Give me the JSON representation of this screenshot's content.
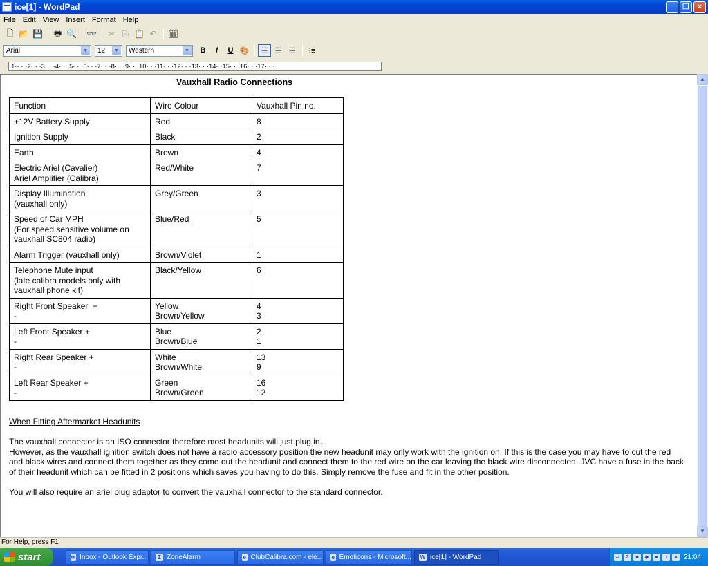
{
  "window": {
    "title": "ice[1] - WordPad",
    "minimize": "_",
    "maximize": "❐",
    "close": "×"
  },
  "menu": [
    "File",
    "Edit",
    "View",
    "Insert",
    "Format",
    "Help"
  ],
  "format_bar": {
    "font": "Arial",
    "size": "12",
    "script": "Western",
    "bold": "B",
    "italic": "I",
    "underline": "U"
  },
  "ruler": "·1·· · ·2· · ·3· · ·4· · ·5· · ·6· · ·7· · ·8· · ·9· · ·10· · ·11· · ·12· · ·13· · ·14· ·15· · ·16· · ·17· · ·",
  "document": {
    "title": "Vauxhall Radio Connections",
    "table": {
      "headers": [
        "Function",
        "Wire Colour",
        "Vauxhall Pin no."
      ],
      "rows": [
        [
          "+12V Battery Supply",
          "Red",
          "8"
        ],
        [
          "Ignition Supply",
          "Black",
          "2"
        ],
        [
          "Earth",
          "Brown",
          "4"
        ],
        [
          "Electric Ariel (Cavalier)\nAriel Amplifier (Calibra)",
          "Red/White",
          "7"
        ],
        [
          "Display Illumination\n(vauxhall only)",
          "Grey/Green",
          "3"
        ],
        [
          "Speed of Car MPH\n(For speed sensitive volume on\nvauxhall SC804 radio)",
          "Blue/Red",
          "5"
        ],
        [
          "Alarm Trigger (vauxhall only)",
          "Brown/Violet",
          "1"
        ],
        [
          "Telephone Mute input\n(late calibra models only with\nvauxhall phone kit)",
          "Black/Yellow",
          "6"
        ],
        [
          "Right Front Speaker  +\n-",
          "Yellow\nBrown/Yellow",
          "4\n3"
        ],
        [
          "Left Front Speaker +\n-",
          "Blue\nBrown/Blue",
          "2\n1"
        ],
        [
          "Right Rear Speaker +\n-",
          "White\nBrown/White",
          "13\n9"
        ],
        [
          "Left Rear Speaker +\n-",
          "Green\nBrown/Green",
          "16\n12"
        ]
      ]
    },
    "heading": "When Fitting Aftermarket Headunits",
    "para1": "The vauxhall connector is an ISO connector therefore most headunits will just plug in.",
    "para2": "However, as the vauxhall ignition switch does not have a radio accessory position the new headunit may only work with the ignition on. If this is the case you may have to cut the red and black wires and connect them together as they come out the headunit and connect them to the red wire on the car leaving the black wire disconnected. JVC have a fuse in the back of their headunit which can be fitted in 2 positions which saves you having to do this. Simply remove the fuse and fit in the other position.",
    "para3": "You will also require an ariel plug adaptor to convert the vauxhall connector to the standard connector."
  },
  "status": "For Help, press F1",
  "taskbar": {
    "start": "start",
    "tasks": [
      "Inbox - Outlook Expr...",
      "ZoneAlarm",
      "ClubCalibra.com - ele...",
      "Emoticons - Microsoft...",
      "ice[1] - WordPad"
    ],
    "clock": "21:04"
  }
}
